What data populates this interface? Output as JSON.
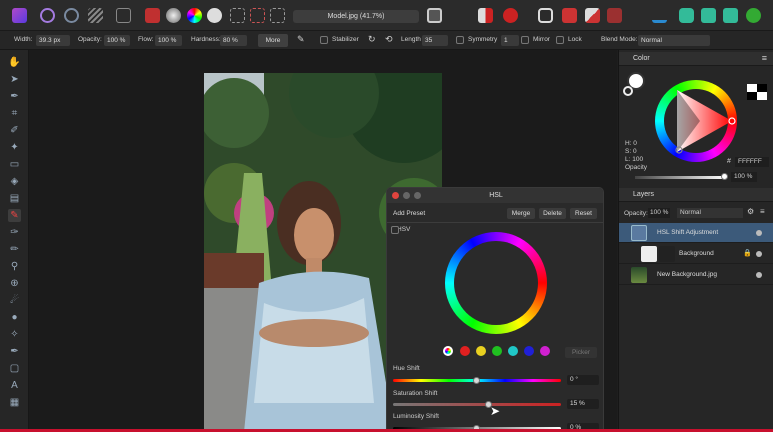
{
  "document": {
    "title": "Model.jpg (41.7%)"
  },
  "context_bar": {
    "width_label": "Width:",
    "width_value": "39.3 px",
    "opacity_label": "Opacity:",
    "opacity_value": "100 %",
    "flow_label": "Flow:",
    "flow_value": "100 %",
    "hardness_label": "Hardness:",
    "hardness_value": "80 %",
    "more_label": "More",
    "stabilizer_label": "Stabilizer",
    "length_label": "Length",
    "length_value": "35",
    "symmetry_label": "Symmetry",
    "symmetry_value": "1",
    "mirror_label": "Mirror",
    "lock_label": "Lock",
    "blend_label": "Blend Mode:",
    "blend_value": "Normal"
  },
  "color_panel": {
    "tab_label": "Color",
    "h_label": "H: 0",
    "s_label": "S: 0",
    "l_label": "L: 100",
    "hex_value": "FFFFFF",
    "opacity_label": "Opacity",
    "opacity_value": "100 %"
  },
  "layers_panel": {
    "tab_label": "Layers",
    "opacity_label": "Opacity:",
    "opacity_value": "100 %",
    "blend_value": "Normal",
    "layers": [
      {
        "name": "HSL Shift Adjustment",
        "selected": true
      },
      {
        "name": "Background",
        "selected": false
      },
      {
        "name": "New Background.jpg",
        "selected": false
      }
    ]
  },
  "hsl_dialog": {
    "title": "HSL",
    "add_preset": "Add Preset",
    "merge": "Merge",
    "delete": "Delete",
    "reset": "Reset",
    "hsv_label": "HSV",
    "picker_label": "Picker",
    "hue_shift_label": "Hue Shift",
    "hue_shift_value": "0 °",
    "hue_shift_position": 0.5,
    "saturation_shift_label": "Saturation Shift",
    "saturation_shift_value": "15 %",
    "saturation_shift_position": 0.57,
    "luminosity_shift_label": "Luminosity Shift",
    "luminosity_shift_value": "0 %",
    "luminosity_shift_position": 0.5,
    "swatch_colors": [
      "#e02020",
      "#e8d020",
      "#20c020",
      "#20c8c8",
      "#2020d8",
      "#d020d0"
    ]
  },
  "colors": {
    "accent": "#2d6fb0",
    "selected_layer": "#3c5a7a"
  }
}
